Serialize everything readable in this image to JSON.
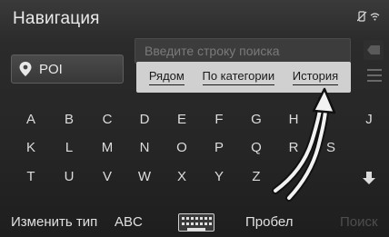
{
  "header": {
    "title": "Навигация",
    "status_icons": [
      "no-phone-icon",
      "wifi-icon"
    ]
  },
  "search": {
    "placeholder": "Введите строку поиска"
  },
  "category_button": {
    "label": "POI",
    "icon": "map-pin-icon"
  },
  "tabs": [
    {
      "label": "Рядом"
    },
    {
      "label": "По категории"
    },
    {
      "label": "История"
    }
  ],
  "keyboard": {
    "row1": [
      "A",
      "B",
      "C",
      "D",
      "E",
      "F",
      "G",
      "H",
      "J"
    ],
    "row2": [
      "K",
      "L",
      "M",
      "N",
      "O",
      "P",
      "Q",
      "R",
      "S"
    ],
    "row3": [
      "T",
      "U",
      "V",
      "W",
      "X",
      "Y",
      "Z"
    ]
  },
  "bottom": {
    "change_type_label": "Изменить тип",
    "abc_label": "ABC",
    "space_label": "Пробел",
    "search_label": "Поиск"
  },
  "colors": {
    "tab_bar_bg": "#d0d0d0",
    "screen_bg": "#262626",
    "text": "#e6e6e6"
  }
}
